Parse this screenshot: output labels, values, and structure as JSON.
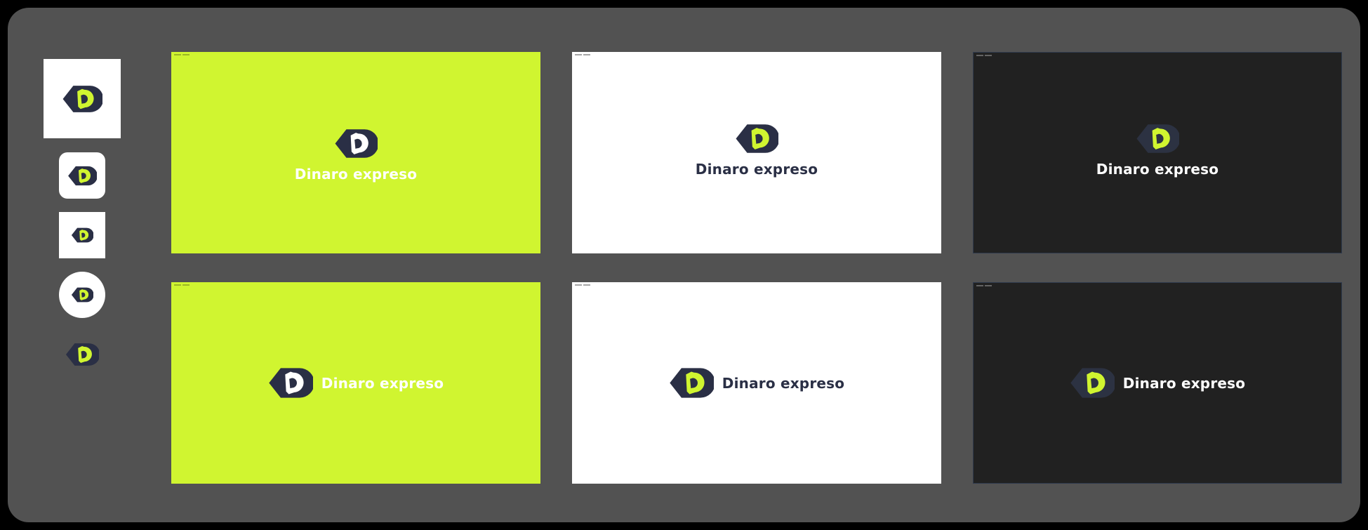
{
  "brand": {
    "name": "Dinaro expreso",
    "colors": {
      "navy": "#2a2f45",
      "lime": "#d0f530",
      "white": "#ffffff",
      "dark": "#212121",
      "board": "#525252"
    },
    "logo_icon": "d-hexagon-mark-icon"
  },
  "cards": [
    {
      "variant": "lime-stacked",
      "label": "Dinaro expreso"
    },
    {
      "variant": "white-stacked",
      "label": "Dinaro expreso"
    },
    {
      "variant": "dark-stacked",
      "label": "Dinaro expreso"
    },
    {
      "variant": "lime-horizontal",
      "label": "Dinaro expreso"
    },
    {
      "variant": "white-horizontal",
      "label": "Dinaro expreso"
    },
    {
      "variant": "dark-horizontal",
      "label": "Dinaro expreso"
    }
  ],
  "app_icons": [
    "square-white-icon",
    "rounded-white-icon",
    "small-square-white-icon",
    "circle-white-icon",
    "bare-mark-icon"
  ]
}
